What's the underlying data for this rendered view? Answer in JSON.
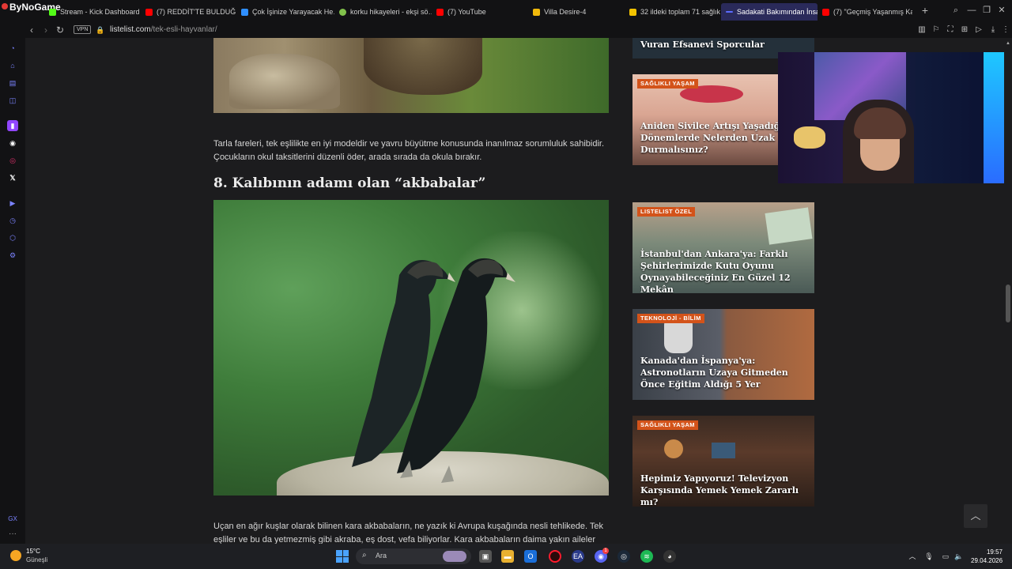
{
  "browser": {
    "logo_text": "ByNoGame",
    "tabs": [
      {
        "label": "Stream - Kick Dashboard",
        "icon": "kick-icon",
        "color": "#53fc18"
      },
      {
        "label": "(7) REDDİT'TE BULDUĞ…",
        "icon": "youtube-icon",
        "color": "#ff0000"
      },
      {
        "label": "Çok İşinize Yarayacak He…",
        "icon": "listelist-icon",
        "color": "#2f8fff"
      },
      {
        "label": "korku hikayeleri - ekşi sö…",
        "icon": "eksi-icon",
        "color": "#81c14b"
      },
      {
        "label": "(7) YouTube",
        "icon": "youtube-icon",
        "color": "#ff0000"
      },
      {
        "label": "Villa Desire-4",
        "icon": "doc-icon",
        "color": "#f0b90b"
      },
      {
        "label": "32 ildeki toplam 71 sağlık…",
        "icon": "news-icon",
        "color": "#f2c300"
      },
      {
        "label": "Sadakati Bakımından İnsan…",
        "icon": "listelist-icon",
        "color": "#5b6cff",
        "active": true
      },
      {
        "label": "(7) \"Geçmiş Yaşanmış Ka…",
        "icon": "youtube-icon",
        "color": "#ff0000"
      }
    ],
    "new_tab": "+",
    "vpn_label": "VPN",
    "url_host": "listelist.com",
    "url_path": "/tek-esli-hayvanlar/"
  },
  "article": {
    "paragraph_1": "Tarla fareleri, tek eşlilikte en iyi modeldir ve yavru büyütme konusunda inanılmaz sorumluluk sahibidir. Çocukların okul taksitlerini düzenli öder, arada sırada da okula bırakır.",
    "heading_8": "8. Kalıbının adamı olan “akbabalar”",
    "paragraph_2": "Uçan en ağır kuşlar olarak bilinen kara akbabaların, ne yazık ki Avrupa kuşağında nesli tehlikede. Tek eşliler ve bu da yetmezmiş gibi akraba, eş dost, vefa biliyorlar. Kara akbabaların daima yakın aileler olarak"
  },
  "sidebar_cards": [
    {
      "tag": "",
      "title": "Vuran Efsanevi Sporcular"
    },
    {
      "tag": "SAĞLIKLI YAŞAM",
      "title": "Aniden Sivilce Artışı Yaşadığınız Dönemlerde Nelerden Uzak Durmalısınız?"
    },
    {
      "tag": "LISTELIST ÖZEL",
      "title": "İstanbul'dan Ankara'ya: Farklı Şehirlerimizde Kutu Oyunu Oynayabileceğiniz En Güzel 12 Mekân"
    },
    {
      "tag": "TEKNOLOJİ - BİLİM",
      "title": "Kanada'dan İspanya'ya: Astronotların Uzaya Gitmeden Önce Eğitim Aldığı 5 Yer"
    },
    {
      "tag": "SAĞLIKLI YAŞAM",
      "title": "Hepimiz Yapıyoruz! Televizyon Karşısında Yemek Yemek Zararlı mı?"
    }
  ],
  "taskbar": {
    "weather_temp": "15°C",
    "weather_desc": "Güneşli",
    "search_placeholder": "Ara",
    "time": "19:57",
    "date": "29.04.2026",
    "notification_count": "1"
  },
  "sidebar_gx_label": "GX"
}
